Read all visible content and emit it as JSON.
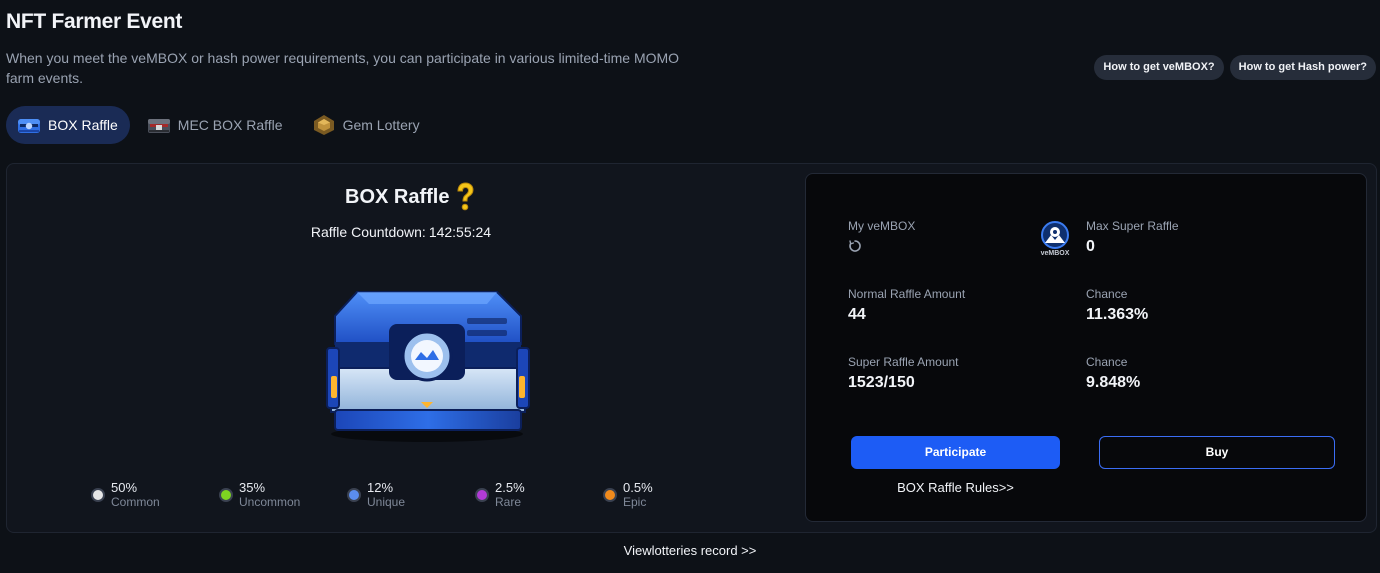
{
  "header": {
    "title": "NFT Farmer Event",
    "description": "When you meet the veMBOX or hash power requirements, you can participate in various limited-time MOMO farm events.",
    "help_buttons": [
      "How to get veMBOX?",
      "How to get Hash power?"
    ]
  },
  "tabs": [
    {
      "label": "BOX Raffle",
      "icon": "blue-box-icon",
      "active": true
    },
    {
      "label": "MEC BOX Raffle",
      "icon": "mec-box-icon",
      "active": false
    },
    {
      "label": "Gem Lottery",
      "icon": "gem-icon",
      "active": false
    }
  ],
  "raffle": {
    "title": "BOX Raffle",
    "countdown_label": "Raffle Countdown:",
    "countdown_value": "142:55:24",
    "rarities": [
      {
        "pct": "50%",
        "name": "Common",
        "color": "#e6e6e6"
      },
      {
        "pct": "35%",
        "name": "Uncommon",
        "color": "#7ed321"
      },
      {
        "pct": "12%",
        "name": "Unique",
        "color": "#5b8def"
      },
      {
        "pct": "2.5%",
        "name": "Rare",
        "color": "#b13bd6"
      },
      {
        "pct": "0.5%",
        "name": "Epic",
        "color": "#f08a1c"
      }
    ]
  },
  "stats": {
    "my_vembox_label": "My veMBOX",
    "vembox_badge_text": "veMBOX",
    "max_super_label": "Max Super Raffle",
    "max_super_value": "0",
    "normal_amount_label": "Normal Raffle Amount",
    "normal_amount_value": "44",
    "normal_chance_label": "Chance",
    "normal_chance_value": "11.363%",
    "super_amount_label": "Super Raffle Amount",
    "super_amount_value": "1523/150",
    "super_chance_label": "Chance",
    "super_chance_value": "9.848%",
    "participate_label": "Participate",
    "buy_label": "Buy",
    "rules_label": "BOX Raffle Rules>>"
  },
  "footer": {
    "records_label": "Viewlotteries record >>"
  },
  "colors": {
    "accent": "#1d5cf5",
    "background": "#0d1117",
    "panel": "#11151d",
    "stats_panel": "#07080b"
  }
}
